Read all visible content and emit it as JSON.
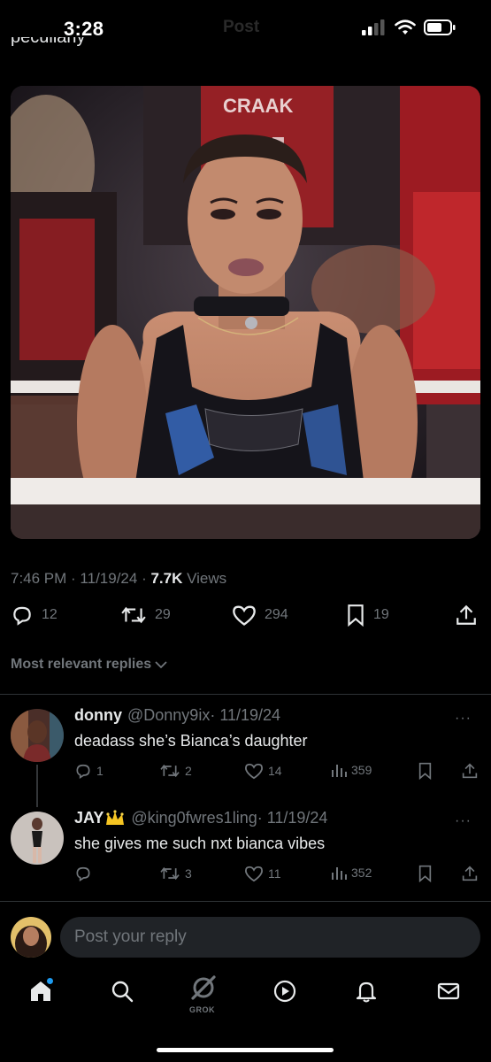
{
  "status_bar": {
    "time": "3:28",
    "ghost_title": "Post"
  },
  "top_cut_text": "peculiarly",
  "media": {
    "alt": "Wrestler standing in ring"
  },
  "post_meta": {
    "time": "7:46 PM",
    "date": "11/19/24",
    "views_count": "7.7K",
    "views_label": "Views"
  },
  "post_actions": {
    "replies": "12",
    "reposts": "29",
    "likes": "294",
    "bookmarks": "19"
  },
  "section_label": "Most relevant replies",
  "replies": [
    {
      "name": "donny",
      "handle": "@Donny9ix",
      "date": "· 11/19/24",
      "text": "deadass she’s Bianca’s daughter",
      "replies": "1",
      "reposts": "2",
      "likes": "14",
      "views": "359"
    },
    {
      "name": "JAY",
      "handle": "@king0fwres1ling",
      "date": "· 11/19/24",
      "text": "she gives me such nxt bianca vibes",
      "replies": "",
      "reposts": "3",
      "likes": "11",
      "views": "352"
    }
  ],
  "reply_input": {
    "placeholder": "Post your reply"
  },
  "bottom_nav": {
    "grok_label": "GROK"
  },
  "colors": {
    "background": "#000000",
    "secondary_text": "#71767b",
    "accent": "#1d9bf0",
    "input_bg": "#202327",
    "divider": "#2f3336"
  },
  "icons": [
    "signal-icon",
    "wifi-icon",
    "battery-icon",
    "reply-icon",
    "repost-icon",
    "like-icon",
    "bookmark-icon",
    "share-icon",
    "views-icon",
    "chevron-down-icon",
    "crown-icon",
    "home-icon",
    "search-icon",
    "grok-icon",
    "play-icon",
    "bell-icon",
    "mail-icon"
  ]
}
